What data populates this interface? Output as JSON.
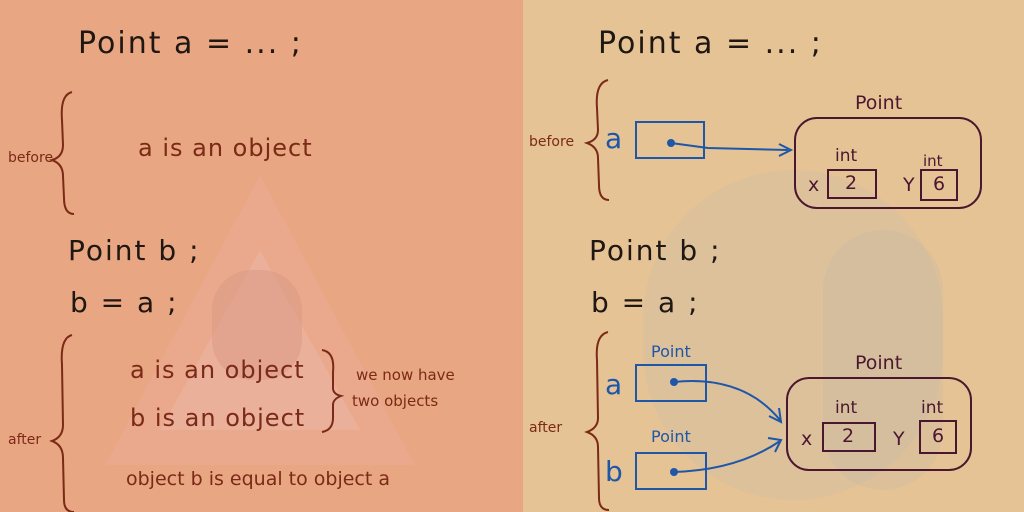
{
  "left": {
    "line1": "Point a = ... ;",
    "before_label": "before",
    "before_note": "a is an object",
    "line2": "Point b ;",
    "line3": "b = a ;",
    "after_label": "after",
    "after_note_a": "a is an object",
    "after_note_b": "b is an object",
    "aside_1": "we now have",
    "aside_2": "two objects",
    "equality_note": "object b is equal to object a"
  },
  "right": {
    "line1": "Point a = ... ;",
    "before_label": "before",
    "var_a": "a",
    "obj_type": "Point",
    "field_type_x": "int",
    "field_type_y": "int",
    "field_x_name": "x",
    "field_x_value": "2",
    "field_y_name": "Y",
    "field_y_value": "6",
    "line2": "Point b ;",
    "line3": "b = a ;",
    "after_label": "after",
    "var_a_after": "a",
    "var_b_after": "b",
    "ref_type_a": "Point",
    "ref_type_b": "Point",
    "obj_type_after": "Point",
    "field_type_x_after": "int",
    "field_type_y_after": "int",
    "field_x_name_after": "x",
    "field_x_value_after": "2",
    "field_y_name_after": "Y",
    "field_y_value_after": "6"
  },
  "colors": {
    "left_bg": "#e9a682",
    "right_bg": "#e6c395",
    "ink_dark": "#1f1712",
    "ink_red": "#7a2a16",
    "ink_blue": "#1e56a8",
    "ink_plum": "#4b1630"
  }
}
